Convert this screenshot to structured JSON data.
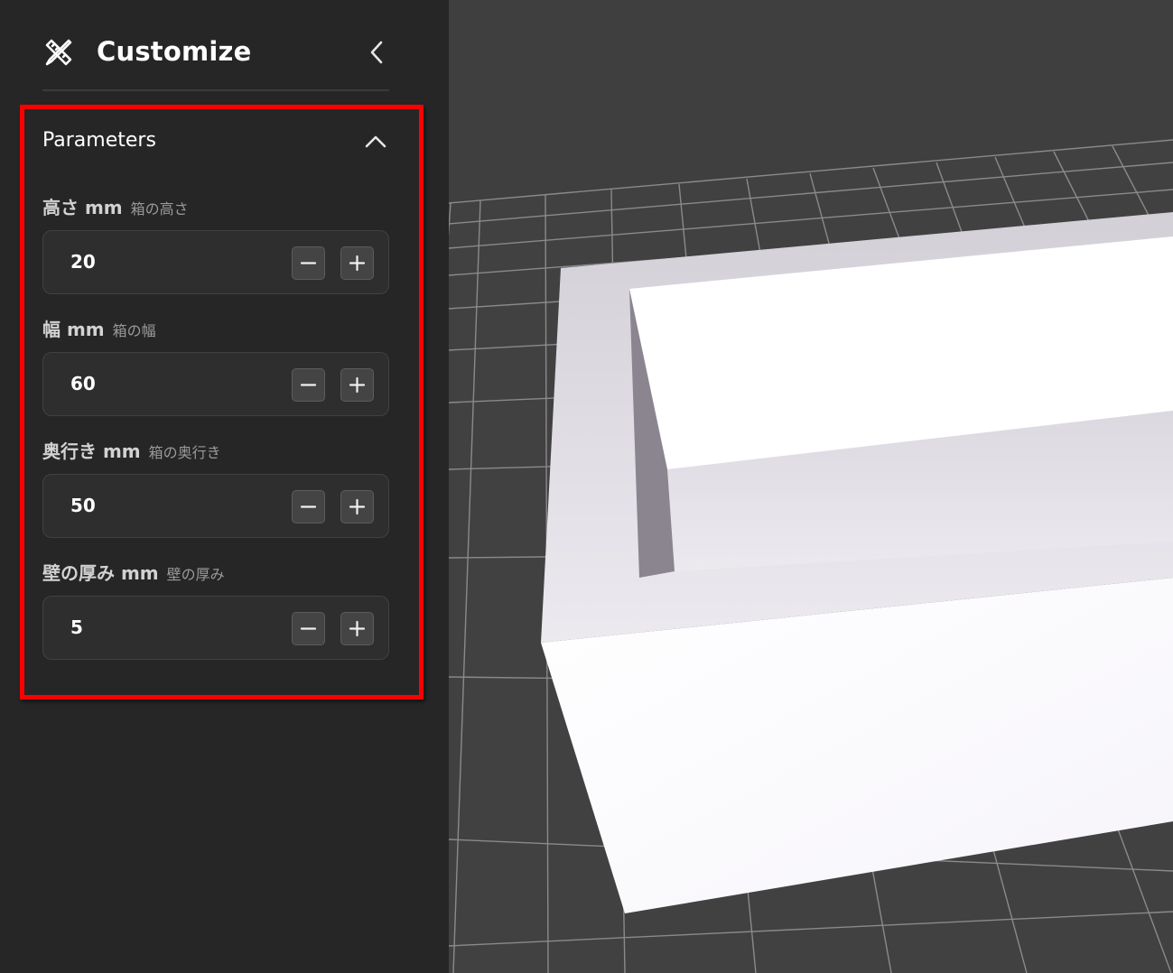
{
  "sidebar": {
    "title": "Customize",
    "brand_icon": "ruler-pencil-icon",
    "collapse_icon": "chevron-left-icon"
  },
  "parameters": {
    "section_title": "Parameters",
    "toggle_icon": "chevron-up-icon",
    "items": [
      {
        "label": "高さ mm",
        "description": "箱の高さ",
        "value": "20"
      },
      {
        "label": "幅 mm",
        "description": "箱の幅",
        "value": "60"
      },
      {
        "label": "奥行き mm",
        "description": "箱の奥行き",
        "value": "50"
      },
      {
        "label": "壁の厚み mm",
        "description": "壁の厚み",
        "value": "5"
      }
    ]
  },
  "colors": {
    "sidebar_bg": "#262626",
    "viewport_bg": "#444444",
    "highlight": "#ff0000",
    "grid": "#8a8a8a",
    "model": "#f2eff5"
  }
}
